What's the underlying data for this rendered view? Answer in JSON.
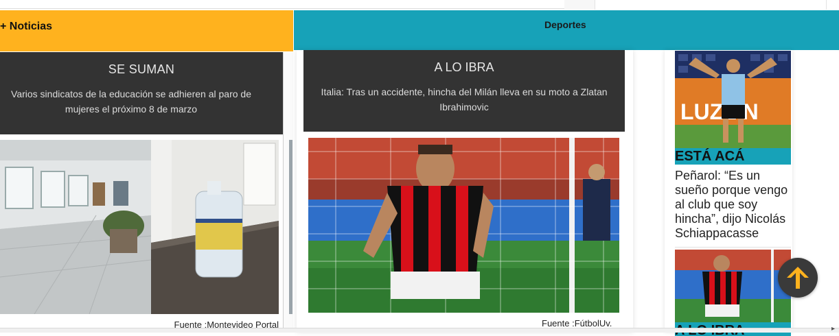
{
  "sections": {
    "noticias_label": "+ Noticias",
    "deportes_label": "Deportes"
  },
  "left_card": {
    "title": "SE SUMAN",
    "description": "Varios sindicatos de la educación se adhieren al paro de mujeres el próximo 8 de marzo",
    "source": "Fuente :Montevideo Portal",
    "image": "hallway-with-hand-sanitizer-bottle"
  },
  "mid_card": {
    "title": "A LO IBRA",
    "description": "Italia: Tras un accidente, hincha del Milán lleva en su moto a Zlatan Ibrahimovic",
    "source": "Fuente :FútbolUv.",
    "image": "footballer-in-red-black-jersey-celebrating"
  },
  "right_list": {
    "items": [
      {
        "image": "uruguay-player-raising-arms",
        "banner_text": "LUZLIN",
        "label": "ESTÁ ACÁ",
        "text": "Peñarol: “Es un sueño porque vengo al club que soy hincha”, dijo Nicolás Schiappacasse"
      },
      {
        "image": "footballer-in-red-black-jersey-celebrating",
        "label": "A LO IBRA"
      }
    ]
  },
  "colors": {
    "noticias": "#ffb21e",
    "deportes": "#17a2b8",
    "card_bg": "#333333"
  },
  "scroll_top_icon": "arrow-up-icon"
}
